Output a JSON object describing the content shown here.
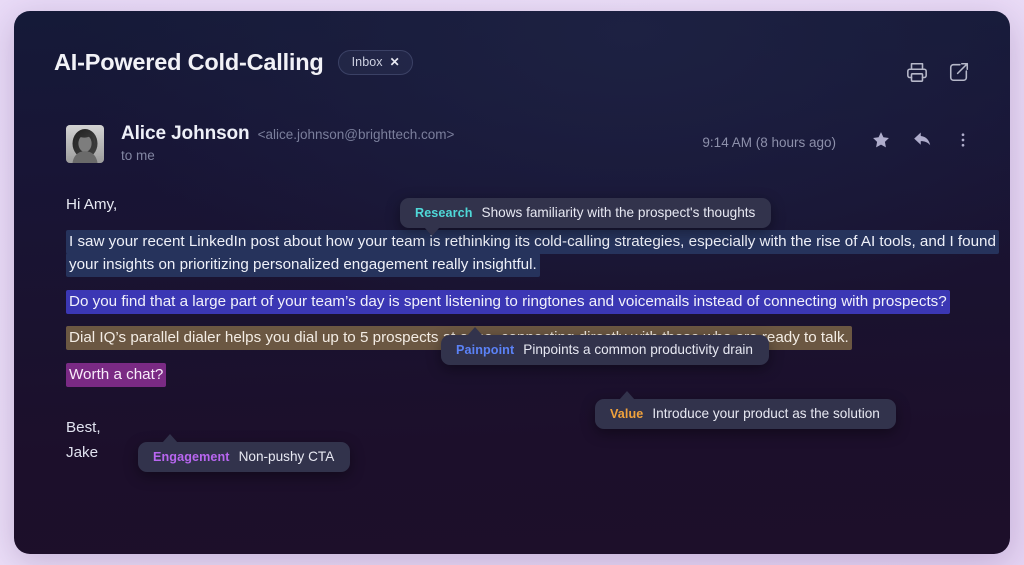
{
  "window": {
    "background_color": "#e9dbf7",
    "card_color": "#181536"
  },
  "header": {
    "subject": "AI-Powered Cold-Calling",
    "label_chip": {
      "text": "Inbox",
      "close_glyph": "✕"
    },
    "actions": [
      {
        "name": "print-icon",
        "label": "Print"
      },
      {
        "name": "open-in-new-window-icon",
        "label": "Open in new window"
      }
    ]
  },
  "message": {
    "sender_name": "Alice Johnson",
    "sender_email": "<alice.johnson@brighttech.com>",
    "recipient": "to me",
    "timestamp": "9:14 AM  (8 hours ago)",
    "avatar_alt": "Alice Johnson profile photo",
    "actions": [
      {
        "name": "star-icon",
        "label": "Star"
      },
      {
        "name": "reply-icon",
        "label": "Reply"
      },
      {
        "name": "more-options-icon",
        "label": "More"
      }
    ]
  },
  "body": {
    "greeting": "Hi Amy,",
    "paragraph_research": "I saw your recent LinkedIn post about how your team is rethinking its cold-calling strategies, especially with the rise of AI tools, and I found your insights on prioritizing personalized engagement really insightful.",
    "paragraph_painpoint": "Do you find that a large part of your team’s day is spent listening to ringtones and voicemails instead of connecting with prospects?",
    "paragraph_value": "Dial IQ’s parallel dialer helps you dial up to 5 prospects at once, connecting directly with those who are ready to talk.",
    "paragraph_engagement": "Worth a chat?",
    "signoff": "Best,",
    "signature_name": "Jake"
  },
  "annotations": [
    {
      "id": "research",
      "tag": "Research",
      "tag_color": "#4fd8d8",
      "description": "Shows familiarity with the prospect's thoughts",
      "highlight_color": "#26335c",
      "tail": "down"
    },
    {
      "id": "painpoint",
      "tag": "Painpoint",
      "tag_color": "#5b82f7",
      "description": "Pinpoints a common productivity drain",
      "highlight_color": "#3b37b4",
      "tail": "up"
    },
    {
      "id": "value",
      "tag": "Value",
      "tag_color": "#f0a23c",
      "description": "Introduce your product as the solution",
      "highlight_color": "#6b5742",
      "tail": "up"
    },
    {
      "id": "engagement",
      "tag": "Engagement",
      "tag_color": "#b866f0",
      "description": "Non-pushy CTA",
      "highlight_color": "#7a2a84",
      "tail": "up"
    }
  ]
}
